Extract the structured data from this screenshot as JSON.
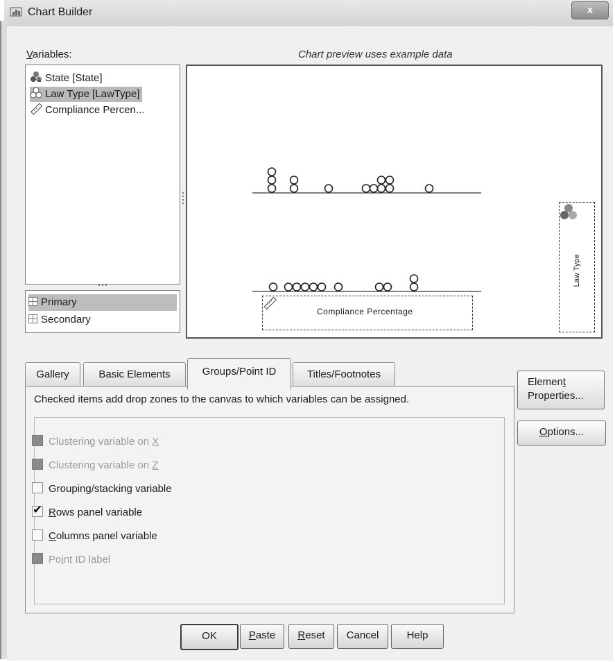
{
  "window": {
    "title": "Chart Builder",
    "close_label": "x"
  },
  "variables": {
    "label": "Variables:",
    "items": [
      {
        "label": "State [State]",
        "icon": "nominal-variable-icon",
        "selected": false
      },
      {
        "label": "Law Type [LawType]",
        "icon": "nominal-variable-icon",
        "selected": true
      },
      {
        "label": "Compliance Percen...",
        "icon": "scale-ruler-icon",
        "selected": false
      }
    ]
  },
  "preview": {
    "caption": "Chart preview uses example data",
    "x_drop_zone": "Compliance Percentage",
    "y_drop_zone": "Law Type"
  },
  "zones": {
    "items": [
      {
        "label": "Primary",
        "selected": true
      },
      {
        "label": "Secondary",
        "selected": false
      }
    ]
  },
  "tabs": [
    {
      "label": "Gallery",
      "active": false
    },
    {
      "label": "Basic Elements",
      "active": false
    },
    {
      "label": "Groups/Point ID",
      "active": true
    },
    {
      "label": "Titles/Footnotes",
      "active": false
    }
  ],
  "groups_panel": {
    "hint": "Checked items add drop zones to the canvas to which variables can be assigned.",
    "options": [
      {
        "pre": "Clustering variable on ",
        "key": "X",
        "post": "",
        "checked": false,
        "disabled": true
      },
      {
        "pre": "Clustering variable on ",
        "key": "Z",
        "post": "",
        "checked": false,
        "disabled": true
      },
      {
        "pre": "Grouping/stacking variable",
        "key": "",
        "post": "",
        "checked": false,
        "disabled": false
      },
      {
        "pre": "",
        "key": "R",
        "post": "ows panel variable",
        "checked": true,
        "disabled": false
      },
      {
        "pre": "",
        "key": "C",
        "post": "olumns panel variable",
        "checked": false,
        "disabled": false
      },
      {
        "pre": "Po",
        "key": "i",
        "post": "nt ID label",
        "checked": false,
        "disabled": true
      }
    ]
  },
  "side_buttons": {
    "element_properties_line1_pre": "Elemen",
    "element_properties_line1_key": "t",
    "element_properties_line2": "Properties...",
    "options_key": "O",
    "options_rest": "ptions..."
  },
  "bottom_buttons": {
    "ok": "OK",
    "paste_key": "P",
    "paste_rest": "aste",
    "reset_key": "R",
    "reset_rest": "eset",
    "cancel": "Cancel",
    "help": "Help"
  }
}
